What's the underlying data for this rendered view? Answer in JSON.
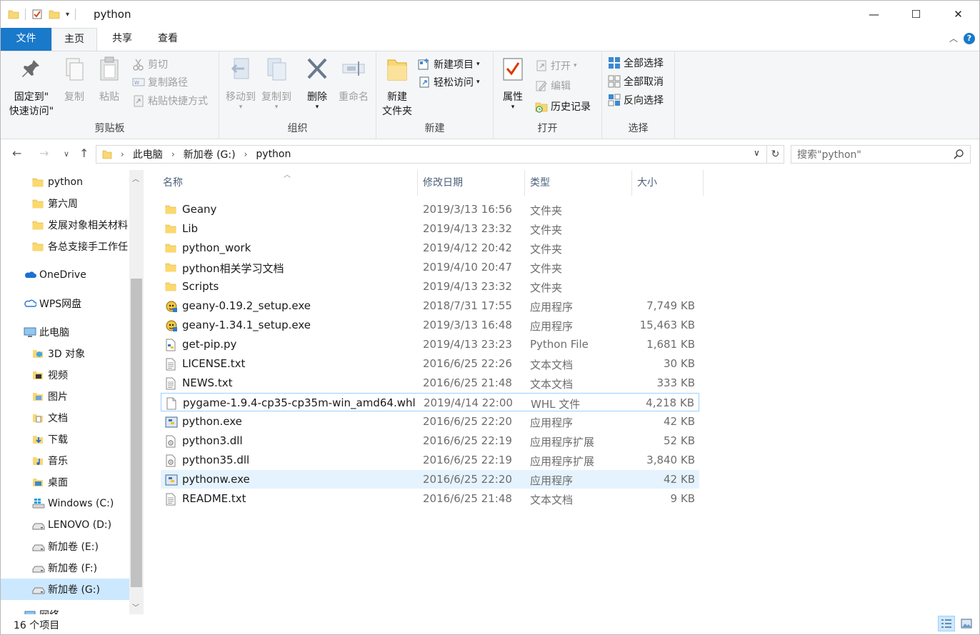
{
  "title": "python",
  "window_buttons": {
    "minimize": "—",
    "maximize": "☐",
    "close": "✕"
  },
  "tabs": [
    {
      "label": "文件"
    },
    {
      "label": "主页"
    },
    {
      "label": "共享"
    },
    {
      "label": "查看"
    }
  ],
  "ribbon": {
    "clipboard": {
      "label": "剪贴板",
      "pin_quick_access_line1": "固定到\"",
      "pin_quick_access_line2": "快速访问\"",
      "copy": "复制",
      "paste": "粘贴",
      "cut": "剪切",
      "copy_path": "复制路径",
      "paste_shortcut": "粘贴快捷方式"
    },
    "organize": {
      "label": "组织",
      "move_to": "移动到",
      "copy_to": "复制到",
      "delete": "删除",
      "rename": "重命名"
    },
    "new": {
      "label": "新建",
      "new_folder_line1": "新建",
      "new_folder_line2": "文件夹",
      "new_item": "新建项目",
      "easy_access": "轻松访问"
    },
    "open": {
      "label": "打开",
      "properties": "属性",
      "open": "打开",
      "edit": "编辑",
      "history": "历史记录"
    },
    "select": {
      "label": "选择",
      "select_all": "全部选择",
      "select_none": "全部取消",
      "invert": "反向选择"
    }
  },
  "address": {
    "crumbs": [
      "此电脑",
      "新加卷 (G:)",
      "python"
    ]
  },
  "search": {
    "placeholder": "搜索\"python\""
  },
  "sidebar": {
    "items": [
      {
        "label": "python",
        "icon": "folder-icon"
      },
      {
        "label": "第六周",
        "icon": "folder-icon"
      },
      {
        "label": "发展对象相关材料",
        "icon": "folder-icon"
      },
      {
        "label": "各总支接手工作任",
        "icon": "folder-icon"
      },
      {
        "label": "OneDrive",
        "icon": "onedrive-icon"
      },
      {
        "label": "WPS网盘",
        "icon": "cloud-icon"
      },
      {
        "label": "此电脑",
        "icon": "computer-icon"
      },
      {
        "label": "3D 对象",
        "icon": "3d-objects-icon"
      },
      {
        "label": "视频",
        "icon": "video-icon"
      },
      {
        "label": "图片",
        "icon": "pictures-icon"
      },
      {
        "label": "文档",
        "icon": "documents-icon"
      },
      {
        "label": "下载",
        "icon": "downloads-icon"
      },
      {
        "label": "音乐",
        "icon": "music-icon"
      },
      {
        "label": "桌面",
        "icon": "desktop-icon"
      },
      {
        "label": "Windows (C:)",
        "icon": "windows-drive-icon"
      },
      {
        "label": "LENOVO (D:)",
        "icon": "drive-icon"
      },
      {
        "label": "新加卷 (E:)",
        "icon": "drive-icon"
      },
      {
        "label": "新加卷 (F:)",
        "icon": "drive-icon"
      },
      {
        "label": "新加卷 (G:)",
        "icon": "drive-icon"
      },
      {
        "label": "网络",
        "icon": "network-icon"
      }
    ]
  },
  "columns": {
    "name": "名称",
    "date": "修改日期",
    "type": "类型",
    "size": "大小"
  },
  "files": [
    {
      "name": "Geany",
      "date": "2019/3/13 16:56",
      "type": "文件夹",
      "size": "",
      "icon": "folder-icon"
    },
    {
      "name": "Lib",
      "date": "2019/4/13 23:32",
      "type": "文件夹",
      "size": "",
      "icon": "folder-icon"
    },
    {
      "name": "python_work",
      "date": "2019/4/12 20:42",
      "type": "文件夹",
      "size": "",
      "icon": "folder-icon"
    },
    {
      "name": "python相关学习文档",
      "date": "2019/4/10 20:47",
      "type": "文件夹",
      "size": "",
      "icon": "folder-icon"
    },
    {
      "name": "Scripts",
      "date": "2019/4/13 23:32",
      "type": "文件夹",
      "size": "",
      "icon": "folder-icon"
    },
    {
      "name": "geany-0.19.2_setup.exe",
      "date": "2018/7/31 17:55",
      "type": "应用程序",
      "size": "7,749 KB",
      "icon": "geany-setup-icon"
    },
    {
      "name": "geany-1.34.1_setup.exe",
      "date": "2019/3/13 16:48",
      "type": "应用程序",
      "size": "15,463 KB",
      "icon": "geany-setup-icon"
    },
    {
      "name": "get-pip.py",
      "date": "2019/4/13 23:23",
      "type": "Python File",
      "size": "1,681 KB",
      "icon": "python-file-icon"
    },
    {
      "name": "LICENSE.txt",
      "date": "2016/6/25 22:26",
      "type": "文本文档",
      "size": "30 KB",
      "icon": "text-file-icon"
    },
    {
      "name": "NEWS.txt",
      "date": "2016/6/25 21:48",
      "type": "文本文档",
      "size": "333 KB",
      "icon": "text-file-icon"
    },
    {
      "name": "pygame-1.9.4-cp35-cp35m-win_amd64.whl",
      "date": "2019/4/14 22:00",
      "type": "WHL 文件",
      "size": "4,218 KB",
      "icon": "blank-file-icon"
    },
    {
      "name": "python.exe",
      "date": "2016/6/25 22:20",
      "type": "应用程序",
      "size": "42 KB",
      "icon": "python-exe-icon"
    },
    {
      "name": "python3.dll",
      "date": "2016/6/25 22:19",
      "type": "应用程序扩展",
      "size": "52 KB",
      "icon": "dll-icon"
    },
    {
      "name": "python35.dll",
      "date": "2016/6/25 22:19",
      "type": "应用程序扩展",
      "size": "3,840 KB",
      "icon": "dll-icon"
    },
    {
      "name": "pythonw.exe",
      "date": "2016/6/25 22:20",
      "type": "应用程序",
      "size": "42 KB",
      "icon": "python-exe-icon"
    },
    {
      "name": "README.txt",
      "date": "2016/6/25 21:48",
      "type": "文本文档",
      "size": "9 KB",
      "icon": "text-file-icon"
    }
  ],
  "status": {
    "item_count": "16 个项目"
  },
  "colors": {
    "accent": "#1979ca",
    "selection": "#cce8ff",
    "hover": "#e5f3ff",
    "folder": "#f8d775"
  }
}
